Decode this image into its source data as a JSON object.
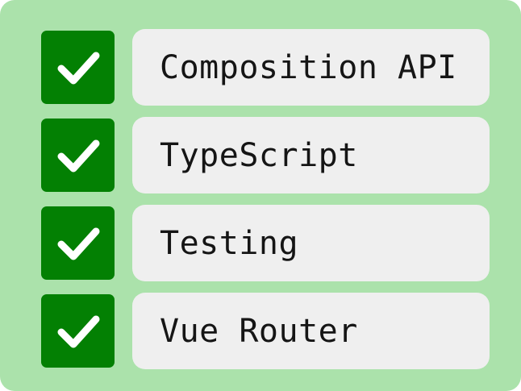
{
  "checklist": {
    "items": [
      {
        "label": "Composition API",
        "checked": true,
        "icon": "check-icon"
      },
      {
        "label": "TypeScript",
        "checked": true,
        "icon": "check-icon"
      },
      {
        "label": "Testing",
        "checked": true,
        "icon": "check-icon"
      },
      {
        "label": "Vue Router",
        "checked": true,
        "icon": "check-icon"
      }
    ]
  },
  "colors": {
    "background": "#abe2ab",
    "checkbox": "#038003",
    "label_box": "#efefef",
    "text": "#151515"
  }
}
